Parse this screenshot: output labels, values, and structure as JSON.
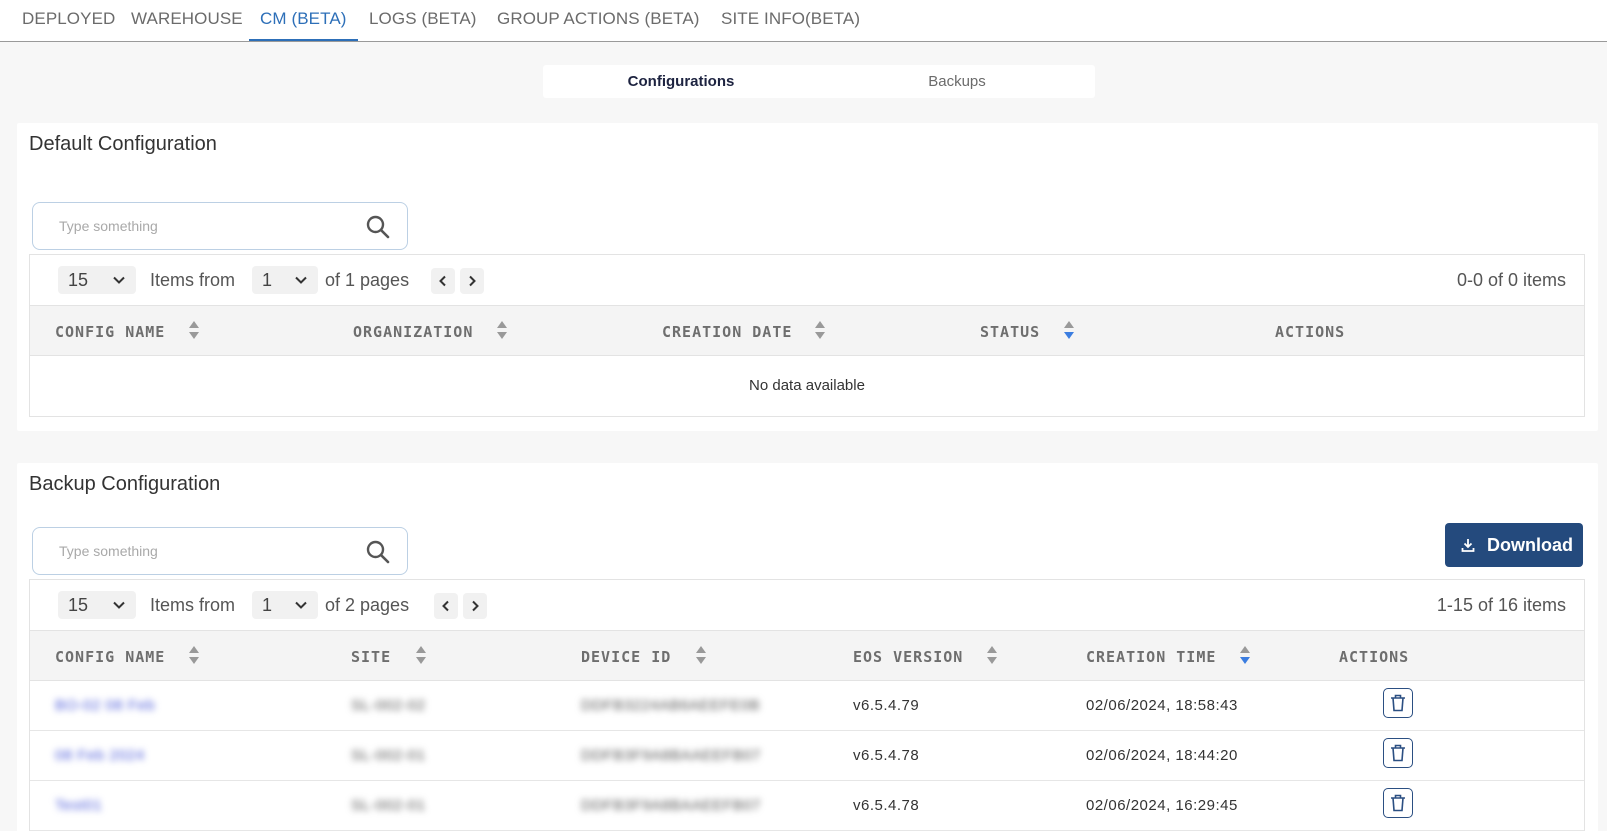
{
  "nav": {
    "tabs": [
      {
        "label": "DEPLOYED"
      },
      {
        "label": "WAREHOUSE"
      },
      {
        "label": "CM (BETA)"
      },
      {
        "label": "LOGS (BETA)"
      },
      {
        "label": "GROUP ACTIONS (BETA)"
      },
      {
        "label": "SITE INFO(BETA)"
      }
    ],
    "active_tab": "CM (BETA)"
  },
  "segmented": {
    "items": [
      "Configurations",
      "Backups"
    ],
    "active": "Configurations"
  },
  "default_config": {
    "title": "Default Configuration",
    "search_placeholder": "Type something",
    "page_size": "15",
    "items_from_label": "Items from",
    "page": "1",
    "of_pages": "of 1 pages",
    "count": "0-0 of 0 items",
    "columns": [
      "CONFIG NAME",
      "ORGANIZATION",
      "CREATION DATE",
      "STATUS",
      "ACTIONS"
    ],
    "empty_text": "No data available"
  },
  "backup_config": {
    "title": "Backup Configuration",
    "search_placeholder": "Type something",
    "download_label": "Download",
    "page_size": "15",
    "items_from_label": "Items from",
    "page": "1",
    "of_pages": "of 2 pages",
    "count": "1-15 of 16 items",
    "columns": [
      "CONFIG NAME",
      "SITE",
      "DEVICE ID",
      "EOS VERSION",
      "CREATION TIME",
      "ACTIONS"
    ],
    "rows": [
      {
        "config_name": "BO-02 08 Feb",
        "site": "SL-002-02",
        "device_id": "DDFB3224AB6AEEFE0B",
        "eos_version": "v6.5.4.79",
        "creation_time": "02/06/2024, 18:58:43"
      },
      {
        "config_name": "08 Feb 2024",
        "site": "SL-002-01",
        "device_id": "DDFB3F9A8BAAEEFB07",
        "eos_version": "v6.5.4.78",
        "creation_time": "02/06/2024, 18:44:20"
      },
      {
        "config_name": "Test01",
        "site": "SL-002-01",
        "device_id": "DDFB3F9A8BAAEEFB07",
        "eos_version": "v6.5.4.78",
        "creation_time": "02/06/2024, 16:29:45"
      }
    ]
  },
  "colors": {
    "accent": "#2d6fb8",
    "download_bg": "#244a7d",
    "sort_active": "#3b7de0",
    "link": "#4b5ad9"
  }
}
